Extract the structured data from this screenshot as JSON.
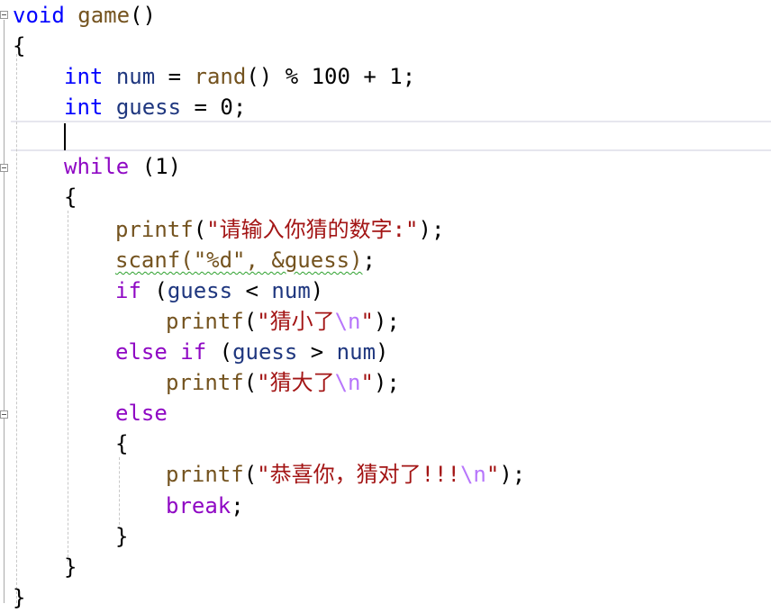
{
  "lines": [
    [
      "void",
      " ",
      "game",
      "()"
    ],
    [
      "{"
    ],
    [
      "int",
      " ",
      "num",
      " = ",
      "rand",
      "() ",
      "%",
      " 100 + 1;"
    ],
    [
      "int",
      " ",
      "guess",
      " = 0;"
    ],
    [],
    [
      "while",
      " (1)"
    ],
    [
      "{"
    ],
    [
      "printf",
      "(",
      "\"请输入你猜的数字:\"",
      ");"
    ],
    [
      "scanf(\"%d\", &guess)",
      ";"
    ],
    [
      "if",
      " (",
      "guess",
      " < ",
      "num",
      ")"
    ],
    [
      "printf",
      "(",
      "\"猜小了",
      "\\n",
      "\"",
      ");"
    ],
    [
      "else",
      " ",
      "if",
      " (",
      "guess",
      " > ",
      "num",
      ")"
    ],
    [
      "printf",
      "(",
      "\"猜大了",
      "\\n",
      "\"",
      ");"
    ],
    [
      "else"
    ],
    [
      "{"
    ],
    [
      "printf",
      "(",
      "\"恭喜你，猜对了!!!",
      "\\n",
      "\"",
      ");"
    ],
    [
      "break",
      ";"
    ],
    [
      "}"
    ],
    [
      "}"
    ],
    [
      "}"
    ]
  ]
}
